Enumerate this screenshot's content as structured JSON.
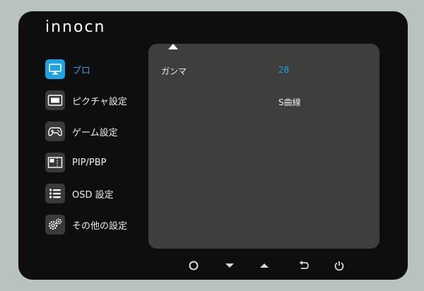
{
  "brand": {
    "logo_text": "innocn"
  },
  "sidebar": {
    "items": [
      {
        "label": "プロ",
        "icon": "monitor-icon",
        "active": true
      },
      {
        "label": "ピクチャ設定",
        "icon": "picture-icon",
        "active": false
      },
      {
        "label": "ゲーム設定",
        "icon": "gamepad-icon",
        "active": false
      },
      {
        "label": "PIP/PBP",
        "icon": "pip-icon",
        "active": false
      },
      {
        "label": "OSD 設定",
        "icon": "list-icon",
        "active": false
      },
      {
        "label": "その他の設定",
        "icon": "gears-icon",
        "active": false
      }
    ]
  },
  "panel": {
    "rows": [
      {
        "label": "ガンマ",
        "value": "28",
        "selected": true
      },
      {
        "label": "",
        "value": "S曲線",
        "selected": false
      }
    ]
  },
  "buttons": [
    {
      "name": "power-circle",
      "icon": "circle-icon"
    },
    {
      "name": "down",
      "icon": "down-arrow-icon"
    },
    {
      "name": "up",
      "icon": "up-arrow-icon"
    },
    {
      "name": "back",
      "icon": "return-icon"
    },
    {
      "name": "power",
      "icon": "power-icon"
    }
  ],
  "colors": {
    "accent": "#1ea2e4",
    "frame": "#0e0e0e",
    "panel": "#3e3e3c",
    "background": "#b8c2c0"
  }
}
